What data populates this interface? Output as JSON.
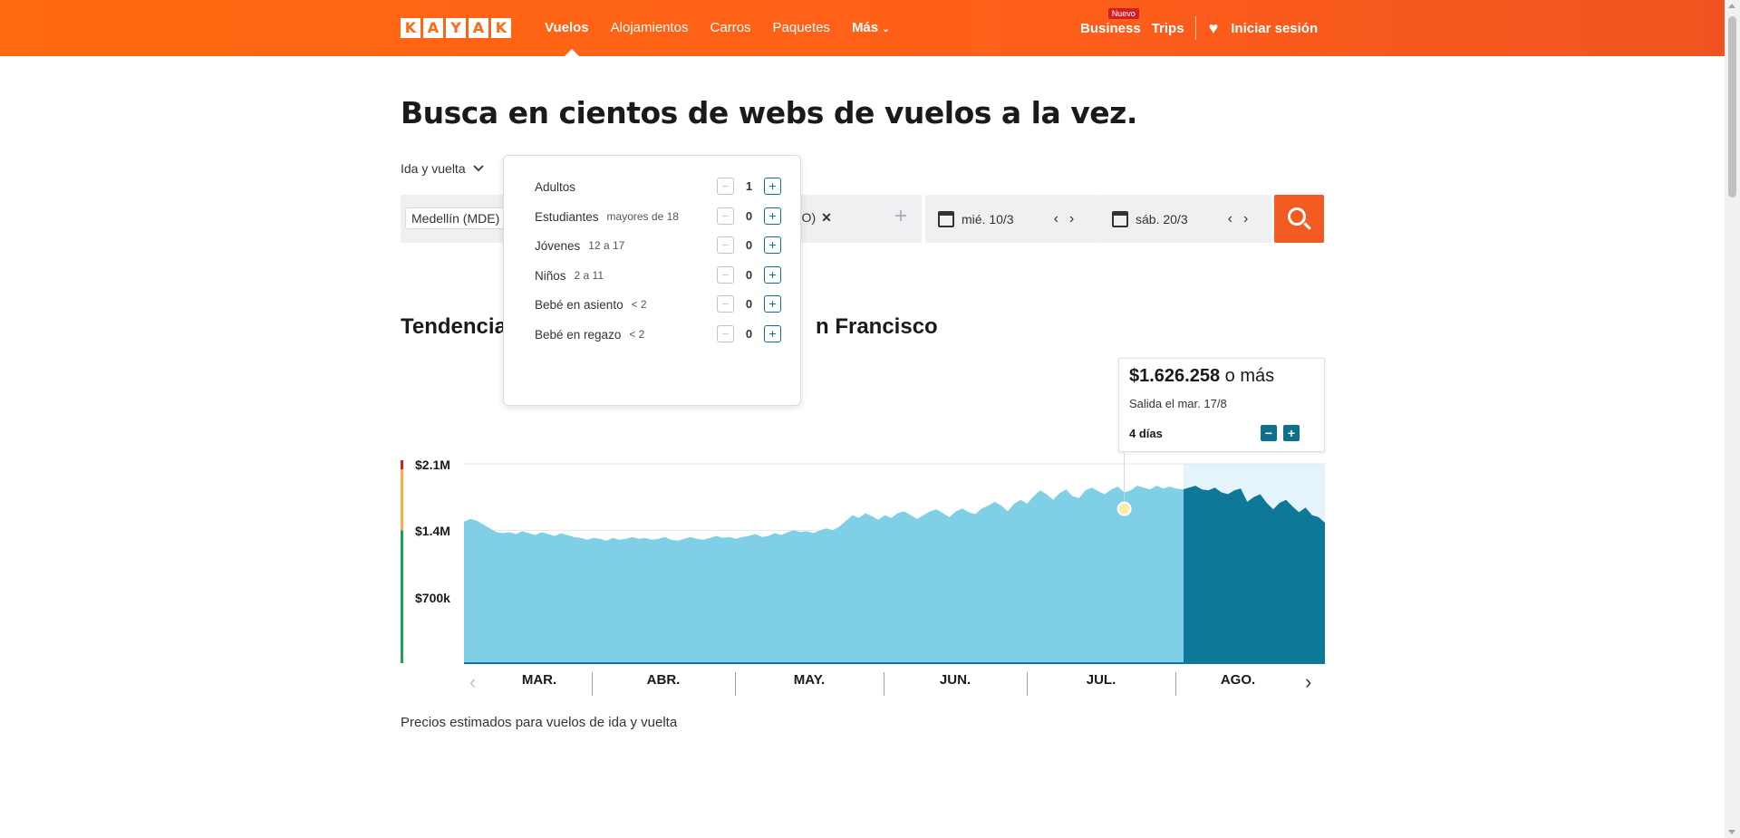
{
  "header": {
    "logo_letters": [
      "K",
      "A",
      "Y",
      "A",
      "K"
    ],
    "nav": [
      "Vuelos",
      "Alojamientos",
      "Carros",
      "Paquetes",
      "Más"
    ],
    "business_label": "Business",
    "business_badge": "Nuevo",
    "trips_label": "Trips",
    "login_label": "Iniciar sesión",
    "brand_color": "#ff690f"
  },
  "page_title": "Busca en cientos de webs de vuelos a la vez.",
  "search": {
    "trip_type": "Ida y vuelta",
    "origin_chip": "Medellín (MDE)",
    "destination_fragment": "FO)",
    "depart_date": "mié. 10/3",
    "return_date": "sáb. 20/3"
  },
  "passengers": [
    {
      "label": "Adultos",
      "sub": "",
      "value": "1",
      "minus": "−",
      "plus": "+"
    },
    {
      "label": "Estudiantes",
      "sub": "mayores de 18",
      "value": "0",
      "minus": "−",
      "plus": "+"
    },
    {
      "label": "Jóvenes",
      "sub": "12 a 17",
      "value": "0",
      "minus": "−",
      "plus": "+"
    },
    {
      "label": "Niños",
      "sub": "2 a 11",
      "value": "0",
      "minus": "−",
      "plus": "+"
    },
    {
      "label": "Bebé en asiento",
      "sub": "< 2",
      "value": "0",
      "minus": "−",
      "plus": "+"
    },
    {
      "label": "Bebé en regazo",
      "sub": "< 2",
      "value": "0",
      "minus": "−",
      "plus": "+"
    }
  ],
  "trend": {
    "title_start": "Tendencia",
    "title_end": "n Francisco",
    "tooltip_price": "$1.626.258",
    "tooltip_suffix": "o más",
    "tooltip_depart": "Salida el mar. 17/8",
    "tooltip_days": "4 días",
    "minus": "−",
    "plus": "+",
    "note": "Precios estimados para vuelos de ida y vuelta"
  },
  "chart_data": {
    "type": "area",
    "y_ticks": [
      "$2.1M",
      "$1.4M",
      "$700k"
    ],
    "ylim": [
      0,
      2100000
    ],
    "months": [
      "MAR.",
      "ABR.",
      "MAY.",
      "JUN.",
      "JUL.",
      "AGO."
    ],
    "highlight_month": "AGO.",
    "series": [
      {
        "values": [
          1490000,
          1520000,
          1500000,
          1460000,
          1420000,
          1380000,
          1370000,
          1380000,
          1360000,
          1390000,
          1370000,
          1350000,
          1380000,
          1360000,
          1340000,
          1370000,
          1350000,
          1330000,
          1320000,
          1300000,
          1320000,
          1310000,
          1290000,
          1320000,
          1300000,
          1310000,
          1330000,
          1310000,
          1320000,
          1300000,
          1310000,
          1330000,
          1300000,
          1290000,
          1310000,
          1330000,
          1310000,
          1300000,
          1320000,
          1340000,
          1320000,
          1330000,
          1310000,
          1330000,
          1340000,
          1360000,
          1330000,
          1340000,
          1370000,
          1350000,
          1380000,
          1400000,
          1380000,
          1390000,
          1370000,
          1400000,
          1420000,
          1400000,
          1440000,
          1500000,
          1560000,
          1530000,
          1580000,
          1550000,
          1510000,
          1560000,
          1530000,
          1580000,
          1600000,
          1560000,
          1520000,
          1560000,
          1600000,
          1620000,
          1580000,
          1540000,
          1600000,
          1630000,
          1590000,
          1570000,
          1630000,
          1660000,
          1700000,
          1660000,
          1600000,
          1680000,
          1720000,
          1680000,
          1760000,
          1820000,
          1780000,
          1720000,
          1790000,
          1830000,
          1760000,
          1740000,
          1820000,
          1850000,
          1810000,
          1780000,
          1830000,
          1860000,
          1800000,
          1820000,
          1870000,
          1850000,
          1830000,
          1870000,
          1840000,
          1860000,
          1840000,
          1830000,
          1850000,
          1870000,
          1830000,
          1820000,
          1850000,
          1800000,
          1780000,
          1820000,
          1840000,
          1700000,
          1750000,
          1780000,
          1690000,
          1620000,
          1690000,
          1720000,
          1650000,
          1590000,
          1640000,
          1560000,
          1540000,
          1480000
        ]
      }
    ]
  }
}
